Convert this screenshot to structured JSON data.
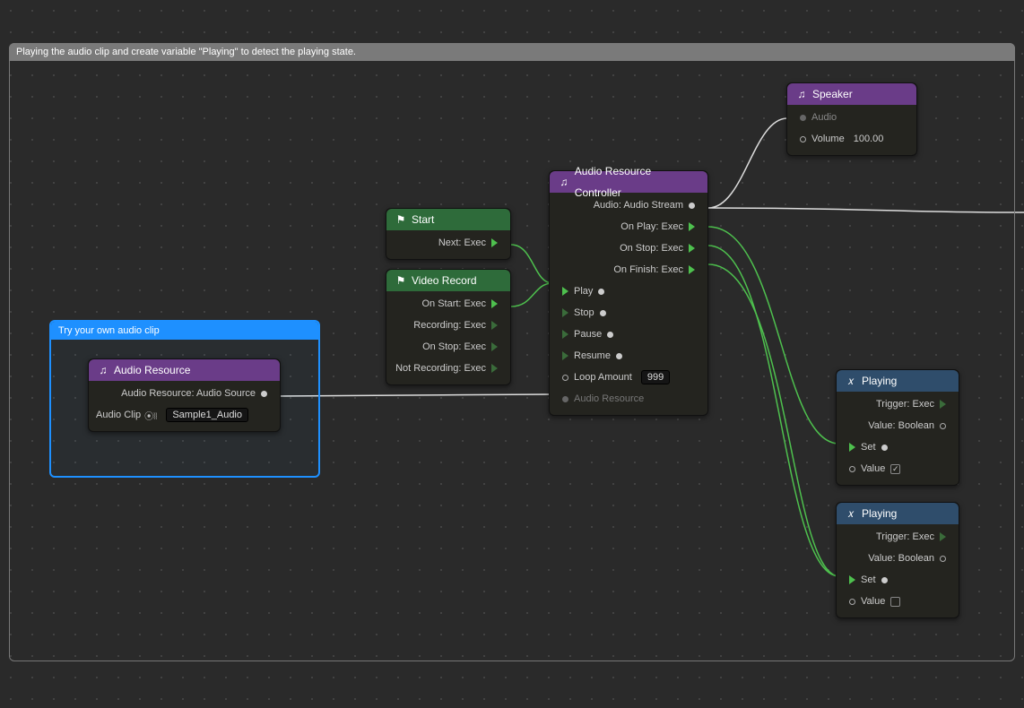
{
  "panel": {
    "title": "Playing the audio clip and create variable \"Playing\" to detect the playing state."
  },
  "highlight": {
    "title": "Try your own audio clip"
  },
  "nodes": {
    "audioResource": {
      "title": "Audio Resource",
      "out_label": "Audio Resource: Audio Source",
      "clip_label": "Audio Clip",
      "clip_value": "Sample1_Audio"
    },
    "start": {
      "title": "Start",
      "out_label": "Next: Exec"
    },
    "videoRecord": {
      "title": "Video Record",
      "rows": {
        "onStart": "On Start: Exec",
        "recording": "Recording: Exec",
        "onStop": "On Stop: Exec",
        "notRecording": "Not Recording: Exec"
      }
    },
    "controller": {
      "title": "Audio Resource Controller",
      "audioOut": "Audio: Audio Stream",
      "onPlay": "On Play: Exec",
      "onStop": "On Stop: Exec",
      "onFinish": "On Finish: Exec",
      "play": "Play",
      "stop": "Stop",
      "pause": "Pause",
      "resume": "Resume",
      "loopLabel": "Loop Amount",
      "loopValue": "999",
      "resourceIn": "Audio Resource"
    },
    "speaker": {
      "title": "Speaker",
      "audioIn": "Audio",
      "volumeLabel": "Volume",
      "volumeValue": "100.00"
    },
    "playingTrue": {
      "title": "Playing",
      "triggerOut": "Trigger: Exec",
      "valueOut": "Value: Boolean",
      "setIn": "Set",
      "valueIn": "Value",
      "checked": true
    },
    "playingFalse": {
      "title": "Playing",
      "triggerOut": "Trigger: Exec",
      "valueOut": "Value: Boolean",
      "setIn": "Set",
      "valueIn": "Value",
      "checked": false
    }
  }
}
